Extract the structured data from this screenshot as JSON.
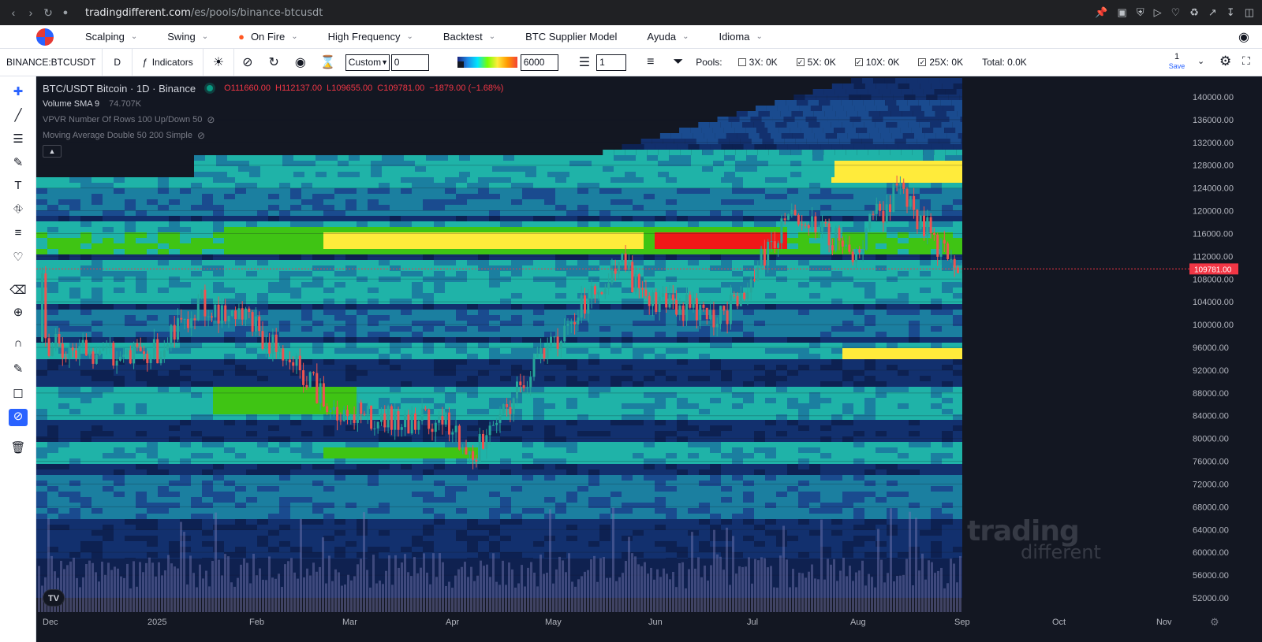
{
  "browser": {
    "url_domain": "tradingdifferent.com",
    "url_path": "/es/pools/binance-btcusdt"
  },
  "menu": {
    "items": [
      {
        "label": "Scalping",
        "has_dropdown": true
      },
      {
        "label": "Swing",
        "has_dropdown": true
      },
      {
        "label": "On Fire",
        "has_dropdown": true
      },
      {
        "label": "High Frequency",
        "has_dropdown": true
      },
      {
        "label": "Backtest",
        "has_dropdown": true
      },
      {
        "label": "BTC Supplier Model",
        "has_dropdown": false
      },
      {
        "label": "Ayuda",
        "has_dropdown": true
      },
      {
        "label": "Idioma",
        "has_dropdown": true
      }
    ]
  },
  "toolbar": {
    "symbol": "BINANCE:BTCUSDT",
    "interval": "D",
    "indicators_label": "Indicators",
    "preset_select": "Custom",
    "preset_value": "0",
    "threshold_value": "6000",
    "layers_value": "1",
    "pools_label": "Pools:",
    "pools": [
      {
        "label": "3X: 0K",
        "checked": false
      },
      {
        "label": "5X: 0K",
        "checked": true
      },
      {
        "label": "10X: 0K",
        "checked": true
      },
      {
        "label": "25X: 0K",
        "checked": true
      }
    ],
    "total_label": "Total: 0.0K",
    "layout_count": "1",
    "save_label": "Save"
  },
  "legend": {
    "title": "BTC/USDT Bitcoin · 1D · Binance",
    "open": "O111660.00",
    "high": "H112137.00",
    "low": "L109655.00",
    "close": "C109781.00",
    "change": "−1879.00 (−1.68%)",
    "volume_label": "Volume SMA 9",
    "volume_value": "74.707K",
    "vpvr_label": "VPVR Number Of Rows 100 Up/Down 50",
    "ma_label": "Moving Average Double 50 200 Simple"
  },
  "watermark": {
    "line1": "trading",
    "line2": "different"
  },
  "tv_logo": "TV",
  "chart_data": {
    "type": "candlestick+heatmap",
    "title": "BTC/USDT Bitcoin · 1D · Binance",
    "last_price_label": "109781.00",
    "y_ticks": [
      "140000.00",
      "136000.00",
      "132000.00",
      "128000.00",
      "124000.00",
      "120000.00",
      "116000.00",
      "112000.00",
      "108000.00",
      "104000.00",
      "100000.00",
      "96000.00",
      "92000.00",
      "88000.00",
      "84000.00",
      "80000.00",
      "76000.00",
      "72000.00",
      "68000.00",
      "64000.00",
      "60000.00",
      "56000.00",
      "52000.00"
    ],
    "y_tick_values": [
      140000,
      136000,
      132000,
      128000,
      124000,
      120000,
      116000,
      112000,
      108000,
      104000,
      100000,
      96000,
      92000,
      88000,
      84000,
      80000,
      76000,
      72000,
      68000,
      64000,
      60000,
      56000,
      52000
    ],
    "x_ticks": [
      "Dec",
      "2025",
      "Feb",
      "Mar",
      "Apr",
      "May",
      "Jun",
      "Jul",
      "Aug",
      "Sep",
      "Oct",
      "Nov"
    ],
    "ylim": [
      50000,
      142500
    ],
    "heat_bands": [
      {
        "from": 113000,
        "to": 116000,
        "level": "high",
        "color": "#ffeb3b"
      },
      {
        "from": 113000,
        "to": 117000,
        "level": "max",
        "color": "#f01818"
      },
      {
        "from": 125000,
        "to": 130000,
        "level": "high",
        "color": "#ffeb3b"
      },
      {
        "from": 94500,
        "to": 96000,
        "level": "high",
        "color": "#ffeb3b"
      },
      {
        "from": 77000,
        "to": 79000,
        "level": "mid",
        "color": "#3fc414"
      }
    ],
    "close_path": [
      {
        "t": "Dec",
        "close": 97000
      },
      {
        "t": "2025",
        "close": 94000
      },
      {
        "t": "Jan-20",
        "close": 104000
      },
      {
        "t": "Feb",
        "close": 100000
      },
      {
        "t": "Mar",
        "close": 84000
      },
      {
        "t": "Apr",
        "close": 83000
      },
      {
        "t": "Apr-08",
        "close": 76000
      },
      {
        "t": "May",
        "close": 95000
      },
      {
        "t": "May-22",
        "close": 111000
      },
      {
        "t": "Jun",
        "close": 105000
      },
      {
        "t": "Jun-22",
        "close": 101000
      },
      {
        "t": "Jul",
        "close": 107000
      },
      {
        "t": "Jul-14",
        "close": 120000
      },
      {
        "t": "Aug",
        "close": 113000
      },
      {
        "t": "Aug-14",
        "close": 123500
      },
      {
        "t": "Sep",
        "close": 109781
      }
    ],
    "colors": {
      "up": "#26a69a",
      "down": "#ef5350",
      "price_line": "#f23645",
      "background": "#131722"
    }
  }
}
